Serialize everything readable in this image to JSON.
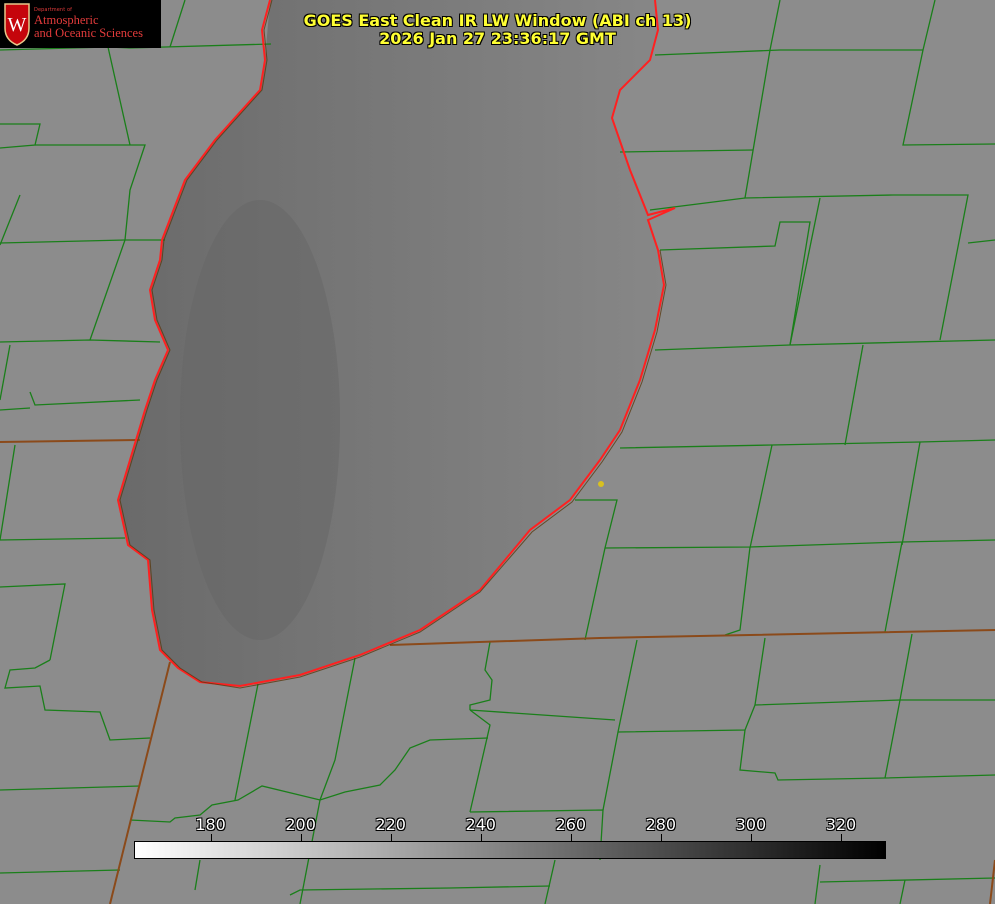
{
  "title": {
    "line1": "GOES East Clean IR LW Window (ABI ch 13)",
    "line2": "2026 Jan 27 23:36:17 GMT"
  },
  "logo": {
    "department": "Department of",
    "line1": "Atmospheric",
    "line2": "and Oceanic Sciences",
    "crest_letter": "W",
    "crest_color": "#c5050c"
  },
  "colorbar": {
    "min": 163,
    "max": 330,
    "ticks": [
      180,
      200,
      220,
      240,
      260,
      280,
      300,
      320
    ],
    "start_color": "#ffffff",
    "end_color": "#000000"
  },
  "colors": {
    "land": "#8c8c8c",
    "lake": "#6e6e6e",
    "county_lines": "#1a7f1a",
    "state_lines": "#8b4a1a",
    "coastline": "#ff2020",
    "marker": "#d8c020",
    "title_text": "#ffff33"
  },
  "marker_icon": "dot-marker"
}
